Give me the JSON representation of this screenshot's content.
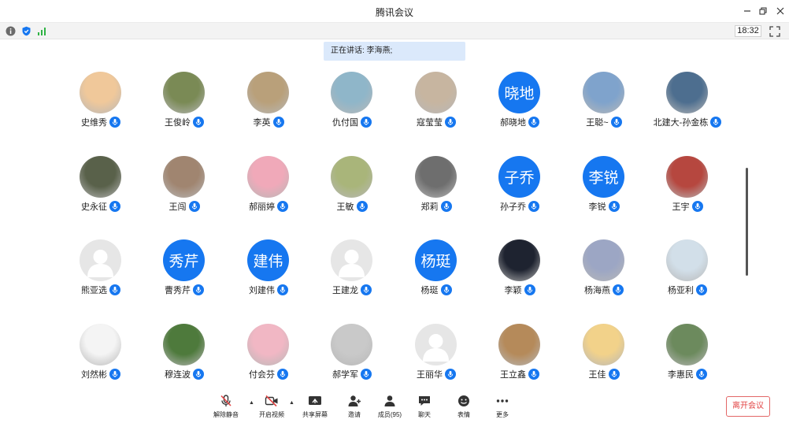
{
  "window": {
    "title": "腾讯会议"
  },
  "status": {
    "clock": "18:32"
  },
  "banner": {
    "speaking": "正在讲话: 李海燕;"
  },
  "participants": [
    {
      "name": "史维秀",
      "avatar": "photo",
      "color": "#f0c89a"
    },
    {
      "name": "王俊岭",
      "avatar": "photo",
      "color": "#7a8a55"
    },
    {
      "name": "李英",
      "avatar": "photo",
      "color": "#b9a07a"
    },
    {
      "name": "仇付国",
      "avatar": "photo",
      "color": "#8fb6c9"
    },
    {
      "name": "寇莹莹",
      "avatar": "photo",
      "color": "#c7b5a0"
    },
    {
      "name": "郝晓地",
      "avatar": "text",
      "text": "晓地"
    },
    {
      "name": "王聪~",
      "avatar": "photo",
      "color": "#7fa3cc"
    },
    {
      "name": "北建大-孙金栋",
      "avatar": "photo",
      "color": "#4d6e8f"
    },
    {
      "name": "史永征",
      "avatar": "photo",
      "color": "#59614a"
    },
    {
      "name": "王闯",
      "avatar": "photo",
      "color": "#a08570"
    },
    {
      "name": "郝丽婷",
      "avatar": "photo",
      "color": "#f0a9b9"
    },
    {
      "name": "王敏",
      "avatar": "photo",
      "color": "#a9b57a"
    },
    {
      "name": "郑莉",
      "avatar": "photo",
      "color": "#6e6e6e"
    },
    {
      "name": "孙子乔",
      "avatar": "text",
      "text": "子乔"
    },
    {
      "name": "李锐",
      "avatar": "text",
      "text": "李锐"
    },
    {
      "name": "王宇",
      "avatar": "photo",
      "color": "#b6473f"
    },
    {
      "name": "熊亚选",
      "avatar": "placeholder"
    },
    {
      "name": "曹秀芹",
      "avatar": "text",
      "text": "秀芹"
    },
    {
      "name": "刘建伟",
      "avatar": "text",
      "text": "建伟"
    },
    {
      "name": "王建龙",
      "avatar": "placeholder"
    },
    {
      "name": "杨珽",
      "avatar": "text",
      "text": "杨珽"
    },
    {
      "name": "李颖",
      "avatar": "photo",
      "color": "#1e2330"
    },
    {
      "name": "杨海燕",
      "avatar": "photo",
      "color": "#9ca6c4"
    },
    {
      "name": "杨亚利",
      "avatar": "photo",
      "color": "#d2dfe9"
    },
    {
      "name": "刘然彬",
      "avatar": "photo",
      "color": "#f4f4f4"
    },
    {
      "name": "穆连波",
      "avatar": "photo",
      "color": "#4e7a3c"
    },
    {
      "name": "付会芬",
      "avatar": "photo",
      "color": "#f1b7c4"
    },
    {
      "name": "郝学军",
      "avatar": "photo",
      "color": "#c9c9c9"
    },
    {
      "name": "王丽华",
      "avatar": "placeholder"
    },
    {
      "name": "王立鑫",
      "avatar": "photo",
      "color": "#b58a5a"
    },
    {
      "name": "王佳",
      "avatar": "photo",
      "color": "#f2d28a"
    },
    {
      "name": "李惠民",
      "avatar": "photo",
      "color": "#6c8a5d"
    }
  ],
  "toolbar": {
    "unmute": "解除静音",
    "video": "开启视频",
    "share": "共享屏幕",
    "invite": "邀请",
    "members": "成员(95)",
    "chat": "聊天",
    "emoji": "表情",
    "more": "更多",
    "leave": "离开会议"
  },
  "icons": {
    "mic": "mic-icon",
    "info": "info-icon",
    "shield": "shield-icon",
    "signal": "signal-icon",
    "fullscreen": "fullscreen-icon"
  },
  "colors": {
    "accent": "#1677f0",
    "leave": "#e24444",
    "banner": "#dbe9fb"
  }
}
